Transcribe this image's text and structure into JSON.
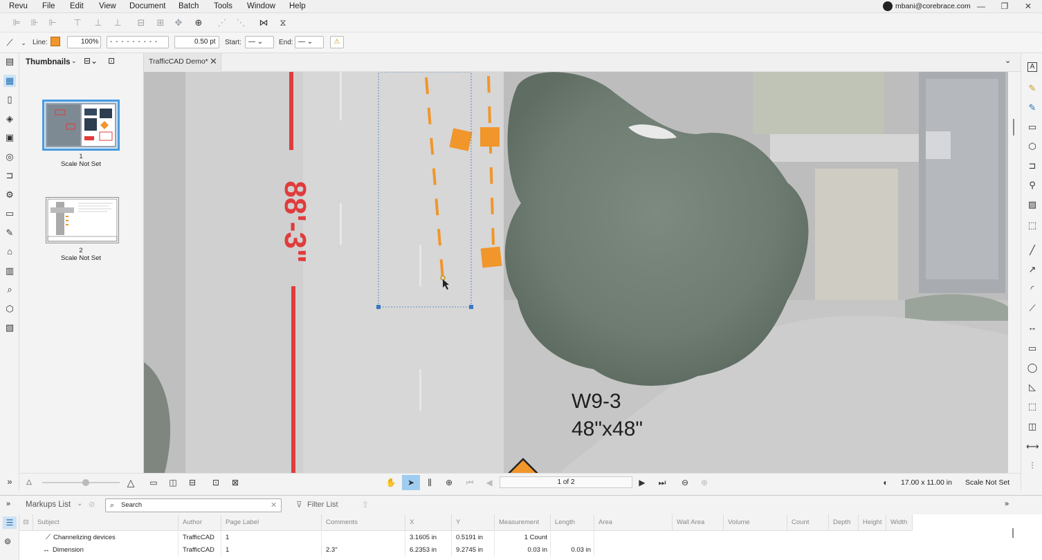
{
  "menu": {
    "items": [
      "Revu",
      "File",
      "Edit",
      "View",
      "Document",
      "Batch",
      "Tools",
      "Window",
      "Help"
    ],
    "user": "mbani@corebrace.com"
  },
  "properties_bar": {
    "line_label": "Line:",
    "line_color": "#f0962b",
    "opacity": "100%",
    "line_width": "0.50 pt",
    "start_label": "Start:",
    "end_label": "End:"
  },
  "thumbnails": {
    "title": "Thumbnails",
    "pages": [
      {
        "number": "1",
        "scale": "Scale Not Set"
      },
      {
        "number": "2",
        "scale": "Scale Not Set"
      }
    ]
  },
  "document": {
    "tab_title": "TrafficCAD Demo*",
    "dimension_label": "88'-3\"",
    "sign_code": "W9-3",
    "sign_size": "48\"x48\""
  },
  "navigation": {
    "page_indicator": "1 of 2",
    "page_size": "17.00 x 11.00 in",
    "scale_status": "Scale Not Set"
  },
  "markups": {
    "title": "Markups List",
    "search_placeholder": "Search",
    "filter_label": "Filter List",
    "columns": [
      "Subject",
      "Author",
      "Page Label",
      "Comments",
      "X",
      "Y",
      "Measurement",
      "Length",
      "Area",
      "Wall Area",
      "Volume",
      "Count",
      "Depth",
      "Height",
      "Width"
    ],
    "rows": [
      {
        "subject": "Channelizing devices",
        "author": "TrafficCAD",
        "page": "1",
        "comments": "",
        "x": "3.1605 in",
        "y": "0.5191 in",
        "measurement": "1 Count",
        "length": ""
      },
      {
        "subject": "Dimension",
        "author": "TrafficCAD",
        "page": "1",
        "comments": "2.3\"",
        "x": "6.2353 in",
        "y": "9.2745 in",
        "measurement": "0.03 in",
        "length": "0.03 in"
      }
    ]
  },
  "colors": {
    "accent": "#4a9be0",
    "markup_orange": "#f0962b",
    "dimension_red": "#e03c3c"
  }
}
